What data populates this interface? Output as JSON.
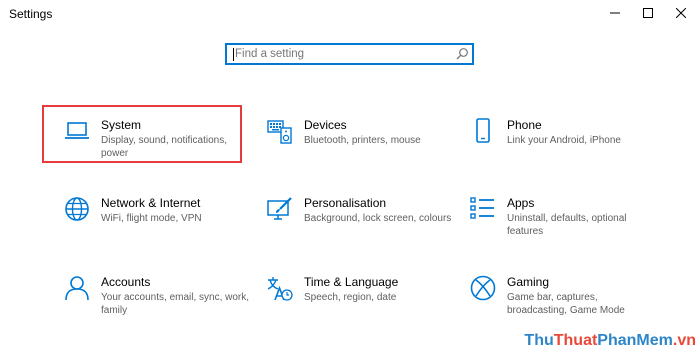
{
  "window": {
    "title": "Settings"
  },
  "search": {
    "placeholder": "Find a setting"
  },
  "tiles": [
    {
      "name": "System",
      "desc": "Display, sound, notifications, power",
      "icon": "laptop-icon"
    },
    {
      "name": "Devices",
      "desc": "Bluetooth, printers, mouse",
      "icon": "keyboard-speaker-icon"
    },
    {
      "name": "Phone",
      "desc": "Link your Android, iPhone",
      "icon": "phone-icon"
    },
    {
      "name": "Network & Internet",
      "desc": "WiFi, flight mode, VPN",
      "icon": "globe-icon"
    },
    {
      "name": "Personalisation",
      "desc": "Background, lock screen, colours",
      "icon": "paint-brush-icon"
    },
    {
      "name": "Apps",
      "desc": "Uninstall, defaults, optional features",
      "icon": "apps-list-icon"
    },
    {
      "name": "Accounts",
      "desc": "Your accounts, email, sync, work, family",
      "icon": "person-icon"
    },
    {
      "name": "Time & Language",
      "desc": "Speech, region, date",
      "icon": "time-language-icon"
    },
    {
      "name": "Gaming",
      "desc": "Game bar, captures, broadcasting, Game Mode",
      "icon": "xbox-icon"
    }
  ],
  "watermark": {
    "part1": "Thu",
    "part2": "Thuat",
    "part3": "PhanMem",
    "part4": ".vn"
  },
  "colors": {
    "accent": "#0078d4",
    "highlight": "#e63b3b"
  }
}
